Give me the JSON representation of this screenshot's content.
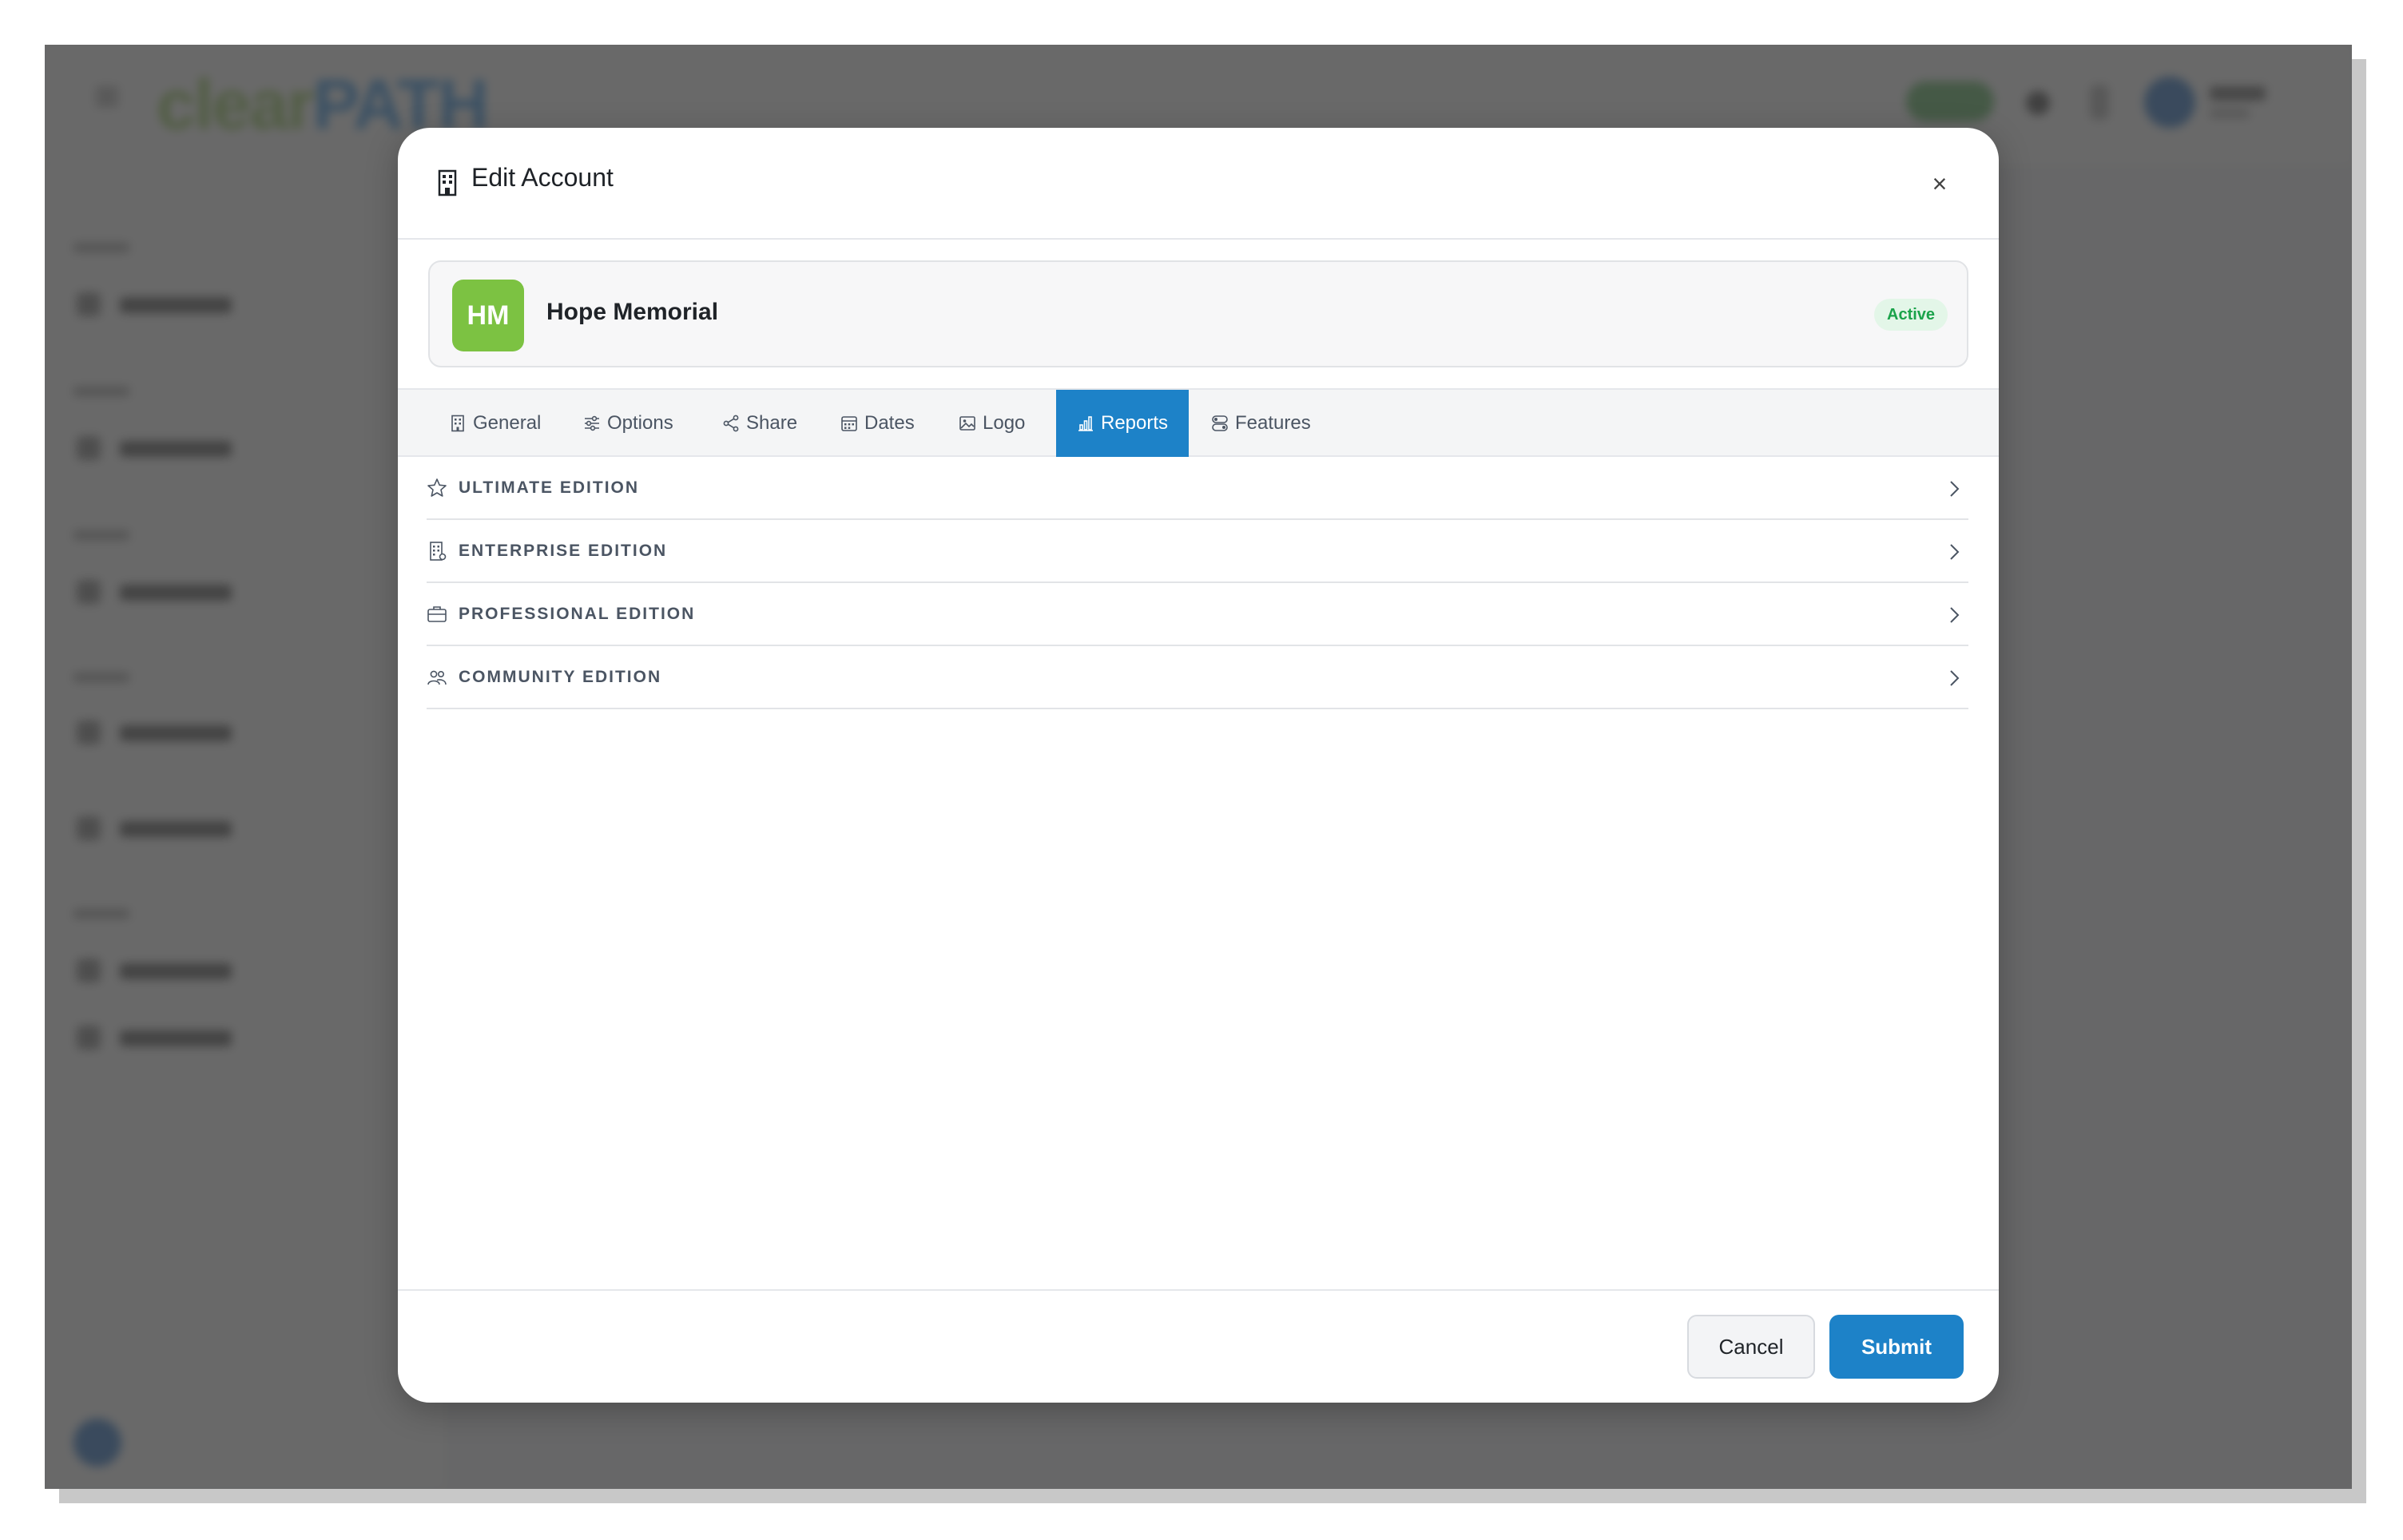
{
  "modal": {
    "title": "Edit Account",
    "title_icon": "building-icon",
    "close_label": "×"
  },
  "account": {
    "initials": "HM",
    "name": "Hope Memorial",
    "status": "Active",
    "avatar_color": "#7cc242",
    "status_color": "#1aa34a"
  },
  "tabs": [
    {
      "label": "General",
      "icon": "building-icon"
    },
    {
      "label": "Options",
      "icon": "sliders-icon"
    },
    {
      "label": "Share",
      "icon": "share-icon"
    },
    {
      "label": "Dates",
      "icon": "calendar-icon"
    },
    {
      "label": "Logo",
      "icon": "image-icon"
    },
    {
      "label": "Reports",
      "icon": "bar-chart-icon",
      "active": true
    },
    {
      "label": "Features",
      "icon": "toggles-icon"
    }
  ],
  "accordion": [
    {
      "label": "ULTIMATE EDITION",
      "icon": "star-icon"
    },
    {
      "label": "ENTERPRISE EDITION",
      "icon": "building-icon"
    },
    {
      "label": "PROFESSIONAL EDITION",
      "icon": "briefcase-icon"
    },
    {
      "label": "COMMUNITY EDITION",
      "icon": "people-icon"
    }
  ],
  "footer": {
    "cancel_label": "Cancel",
    "submit_label": "Submit"
  },
  "colors": {
    "accent": "#1d82c8",
    "overlay": "#444444"
  }
}
